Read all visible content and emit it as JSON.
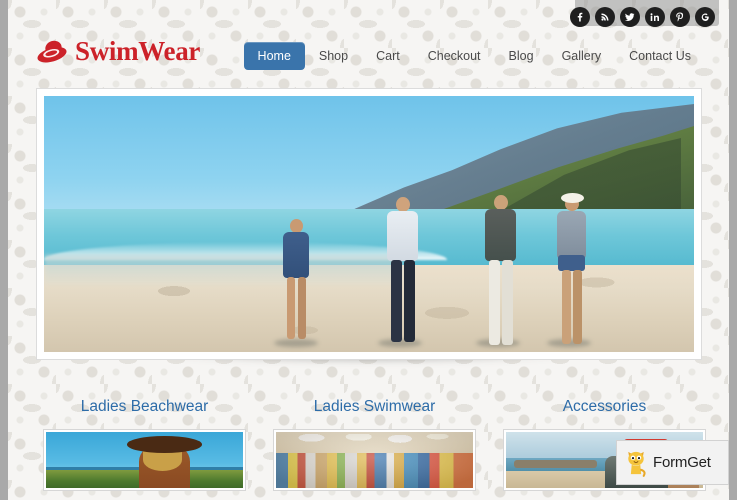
{
  "site": {
    "brand": {
      "name": "SwimWear",
      "icon": "sun-hat-icon",
      "color": "#cc2229"
    },
    "accent_color": "#3a74ab",
    "heading_color": "#2d6ca8"
  },
  "social": {
    "items": [
      {
        "name": "facebook",
        "glyph": "f"
      },
      {
        "name": "rss",
        "glyph": "rss"
      },
      {
        "name": "twitter",
        "glyph": "t"
      },
      {
        "name": "linkedin",
        "glyph": "in"
      },
      {
        "name": "pinterest",
        "glyph": "P"
      },
      {
        "name": "google-plus",
        "glyph": "G"
      }
    ]
  },
  "nav": {
    "items": [
      {
        "label": "Home",
        "active": true
      },
      {
        "label": "Shop",
        "active": false
      },
      {
        "label": "Cart",
        "active": false
      },
      {
        "label": "Checkout",
        "active": false
      },
      {
        "label": "Blog",
        "active": false
      },
      {
        "label": "Gallery",
        "active": false
      },
      {
        "label": "Contact Us",
        "active": false
      }
    ]
  },
  "slider": {
    "alt": "Four people walking along a sunny beach with green coastal mountains"
  },
  "categories": [
    {
      "title": "Ladies Beachwear",
      "image_alt": "Woman in a wide sun hat looking out to the sea"
    },
    {
      "title": "Ladies Swimwear",
      "image_alt": "Colorful clothing store interior with racks of swimwear"
    },
    {
      "title": "Accessories",
      "image_alt": "Red cooler on the roof of a car parked at the beach"
    }
  ],
  "watermark": {
    "label": "FormGet",
    "icon": "cat-mascot-icon"
  }
}
